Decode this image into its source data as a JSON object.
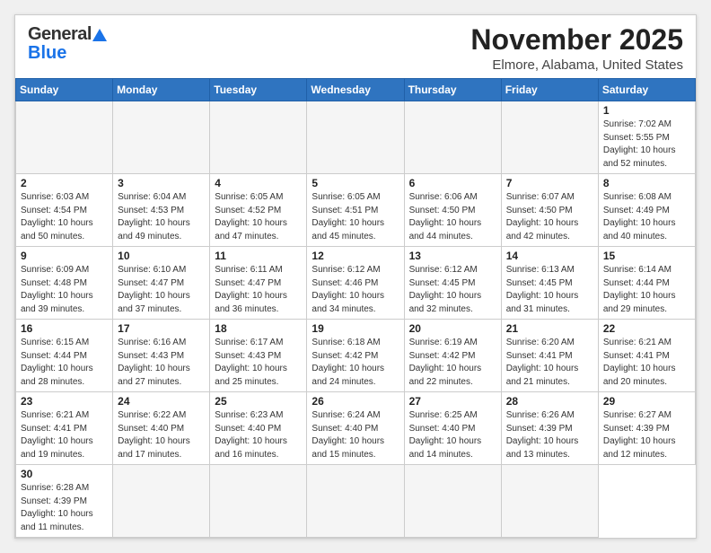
{
  "header": {
    "month_title": "November 2025",
    "location": "Elmore, Alabama, United States",
    "logo_line1": "General",
    "logo_line2": "Blue"
  },
  "weekdays": [
    "Sunday",
    "Monday",
    "Tuesday",
    "Wednesday",
    "Thursday",
    "Friday",
    "Saturday"
  ],
  "days": [
    {
      "date": null,
      "info": null
    },
    {
      "date": null,
      "info": null
    },
    {
      "date": null,
      "info": null
    },
    {
      "date": null,
      "info": null
    },
    {
      "date": null,
      "info": null
    },
    {
      "date": null,
      "info": null
    },
    {
      "date": "1",
      "info": "Sunrise: 7:02 AM\nSunset: 5:55 PM\nDaylight: 10 hours\nand 52 minutes."
    },
    {
      "date": "2",
      "info": "Sunrise: 6:03 AM\nSunset: 4:54 PM\nDaylight: 10 hours\nand 50 minutes."
    },
    {
      "date": "3",
      "info": "Sunrise: 6:04 AM\nSunset: 4:53 PM\nDaylight: 10 hours\nand 49 minutes."
    },
    {
      "date": "4",
      "info": "Sunrise: 6:05 AM\nSunset: 4:52 PM\nDaylight: 10 hours\nand 47 minutes."
    },
    {
      "date": "5",
      "info": "Sunrise: 6:05 AM\nSunset: 4:51 PM\nDaylight: 10 hours\nand 45 minutes."
    },
    {
      "date": "6",
      "info": "Sunrise: 6:06 AM\nSunset: 4:50 PM\nDaylight: 10 hours\nand 44 minutes."
    },
    {
      "date": "7",
      "info": "Sunrise: 6:07 AM\nSunset: 4:50 PM\nDaylight: 10 hours\nand 42 minutes."
    },
    {
      "date": "8",
      "info": "Sunrise: 6:08 AM\nSunset: 4:49 PM\nDaylight: 10 hours\nand 40 minutes."
    },
    {
      "date": "9",
      "info": "Sunrise: 6:09 AM\nSunset: 4:48 PM\nDaylight: 10 hours\nand 39 minutes."
    },
    {
      "date": "10",
      "info": "Sunrise: 6:10 AM\nSunset: 4:47 PM\nDaylight: 10 hours\nand 37 minutes."
    },
    {
      "date": "11",
      "info": "Sunrise: 6:11 AM\nSunset: 4:47 PM\nDaylight: 10 hours\nand 36 minutes."
    },
    {
      "date": "12",
      "info": "Sunrise: 6:12 AM\nSunset: 4:46 PM\nDaylight: 10 hours\nand 34 minutes."
    },
    {
      "date": "13",
      "info": "Sunrise: 6:12 AM\nSunset: 4:45 PM\nDaylight: 10 hours\nand 32 minutes."
    },
    {
      "date": "14",
      "info": "Sunrise: 6:13 AM\nSunset: 4:45 PM\nDaylight: 10 hours\nand 31 minutes."
    },
    {
      "date": "15",
      "info": "Sunrise: 6:14 AM\nSunset: 4:44 PM\nDaylight: 10 hours\nand 29 minutes."
    },
    {
      "date": "16",
      "info": "Sunrise: 6:15 AM\nSunset: 4:44 PM\nDaylight: 10 hours\nand 28 minutes."
    },
    {
      "date": "17",
      "info": "Sunrise: 6:16 AM\nSunset: 4:43 PM\nDaylight: 10 hours\nand 27 minutes."
    },
    {
      "date": "18",
      "info": "Sunrise: 6:17 AM\nSunset: 4:43 PM\nDaylight: 10 hours\nand 25 minutes."
    },
    {
      "date": "19",
      "info": "Sunrise: 6:18 AM\nSunset: 4:42 PM\nDaylight: 10 hours\nand 24 minutes."
    },
    {
      "date": "20",
      "info": "Sunrise: 6:19 AM\nSunset: 4:42 PM\nDaylight: 10 hours\nand 22 minutes."
    },
    {
      "date": "21",
      "info": "Sunrise: 6:20 AM\nSunset: 4:41 PM\nDaylight: 10 hours\nand 21 minutes."
    },
    {
      "date": "22",
      "info": "Sunrise: 6:21 AM\nSunset: 4:41 PM\nDaylight: 10 hours\nand 20 minutes."
    },
    {
      "date": "23",
      "info": "Sunrise: 6:21 AM\nSunset: 4:41 PM\nDaylight: 10 hours\nand 19 minutes."
    },
    {
      "date": "24",
      "info": "Sunrise: 6:22 AM\nSunset: 4:40 PM\nDaylight: 10 hours\nand 17 minutes."
    },
    {
      "date": "25",
      "info": "Sunrise: 6:23 AM\nSunset: 4:40 PM\nDaylight: 10 hours\nand 16 minutes."
    },
    {
      "date": "26",
      "info": "Sunrise: 6:24 AM\nSunset: 4:40 PM\nDaylight: 10 hours\nand 15 minutes."
    },
    {
      "date": "27",
      "info": "Sunrise: 6:25 AM\nSunset: 4:40 PM\nDaylight: 10 hours\nand 14 minutes."
    },
    {
      "date": "28",
      "info": "Sunrise: 6:26 AM\nSunset: 4:39 PM\nDaylight: 10 hours\nand 13 minutes."
    },
    {
      "date": "29",
      "info": "Sunrise: 6:27 AM\nSunset: 4:39 PM\nDaylight: 10 hours\nand 12 minutes."
    },
    {
      "date": "30",
      "info": "Sunrise: 6:28 AM\nSunset: 4:39 PM\nDaylight: 10 hours\nand 11 minutes."
    },
    {
      "date": null,
      "info": null
    },
    {
      "date": null,
      "info": null
    },
    {
      "date": null,
      "info": null
    },
    {
      "date": null,
      "info": null
    },
    {
      "date": null,
      "info": null
    }
  ]
}
